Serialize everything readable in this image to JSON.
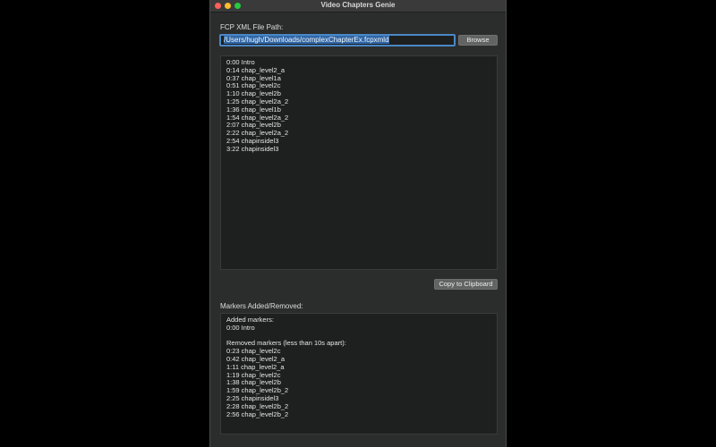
{
  "window": {
    "title": "Video Chapters Genie"
  },
  "file_section": {
    "label": "FCP XML File Path:",
    "path_value": "/Users/hugh/Downloads/complexChapterEx.fcpxmld",
    "browse_label": "Browse"
  },
  "chapters": {
    "lines": [
      "0:00 Intro",
      "0:14 chap_level2_a",
      "0:37 chap_level1a",
      "0:51 chap_level2c",
      "1:10 chap_level2b",
      "1:25 chap_level2a_2",
      "1:36 chap_level1b",
      "1:54 chap_level2a_2",
      "2:07 chap_level2b",
      "2:22 chap_level2a_2",
      "2:54 chapinsidel3",
      "3:22 chapinsidel3"
    ],
    "copy_label": "Copy to Clipboard"
  },
  "markers": {
    "label": "Markers Added/Removed:",
    "added_heading": "Added markers:",
    "added": [
      "0:00 Intro"
    ],
    "removed_heading": "Removed markers (less than 10s apart):",
    "removed": [
      "0:23 chap_level2c",
      "0:42 chap_level2_a",
      "1:11 chap_level2_a",
      "1:19 chap_level2c",
      "1:38 chap_level2b",
      "1:59 chap_level2b_2",
      "2:25 chapinsidel3",
      "2:28 chap_level2b_2",
      "2:56 chap_level2b_2"
    ]
  },
  "colors": {
    "window_bg": "#2b2d2d",
    "text_area_bg": "#1e1f1f",
    "focus_ring": "#4a88c7",
    "button_bg": "#626463"
  }
}
